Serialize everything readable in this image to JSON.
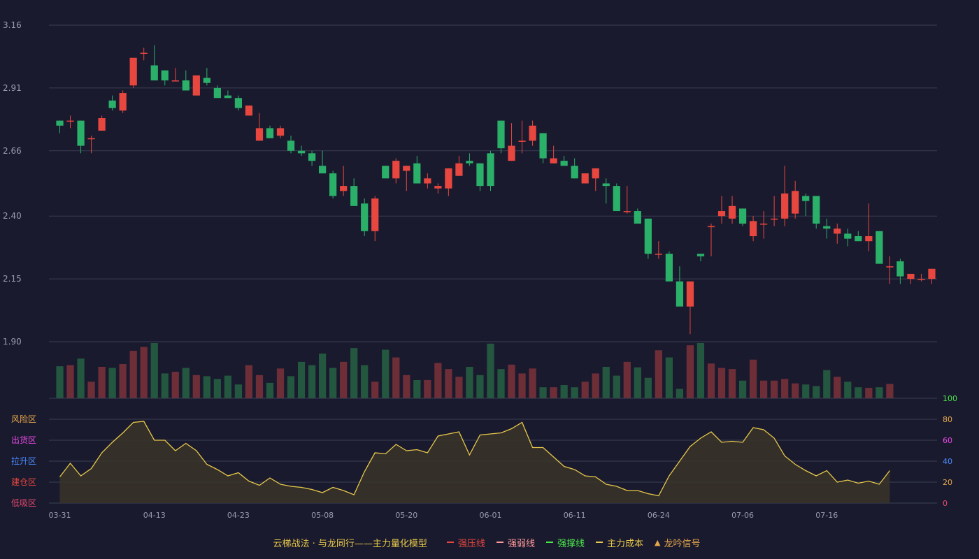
{
  "colors": {
    "background": "#1a1a2e",
    "up": "#e8473f",
    "down": "#2bb06a",
    "up_volume": "#6e2e38",
    "down_volume": "#24573f",
    "grid": "#3a3d52",
    "axis_text": "#9a9cad",
    "oscillator_line": "#e6c84a",
    "oscillator_fill": "#3a3428"
  },
  "chart_data": [
    {
      "type": "candlestick",
      "dates": [
        "03-31",
        "04-01",
        "04-02",
        "04-03",
        "04-06",
        "04-07",
        "04-08",
        "04-09",
        "04-10",
        "04-13",
        "04-14",
        "04-15",
        "04-16",
        "04-17",
        "04-20",
        "04-21",
        "04-22",
        "04-23",
        "04-24",
        "04-27",
        "04-28",
        "04-29",
        "04-30",
        "05-01",
        "05-04",
        "05-05",
        "05-06",
        "05-07",
        "05-08",
        "05-11",
        "05-12",
        "05-13",
        "05-14",
        "05-15",
        "05-18",
        "05-19",
        "05-20",
        "05-21",
        "05-22",
        "05-25",
        "05-26",
        "05-27",
        "05-28",
        "05-29",
        "06-01",
        "06-02",
        "06-03",
        "06-04",
        "06-05",
        "06-08",
        "06-09",
        "06-10",
        "06-11",
        "06-12",
        "06-15",
        "06-16",
        "06-17",
        "06-18",
        "06-19",
        "06-22",
        "06-23",
        "06-24",
        "06-25",
        "06-26",
        "06-29",
        "06-30",
        "07-01",
        "07-02",
        "07-03",
        "07-06",
        "07-07",
        "07-08",
        "07-09",
        "07-10",
        "07-13",
        "07-14",
        "07-15",
        "07-16",
        "07-17",
        "07-20",
        "07-21",
        "07-22",
        "07-23",
        "07-24",
        "07-27",
        "07-28",
        "07-29",
        "07-30",
        "07-31",
        "08-03"
      ],
      "ohlc": [
        [
          2.78,
          2.78,
          2.73,
          2.76
        ],
        [
          2.78,
          2.8,
          2.75,
          2.78
        ],
        [
          2.78,
          2.78,
          2.65,
          2.68
        ],
        [
          2.71,
          2.72,
          2.65,
          2.71
        ],
        [
          2.74,
          2.8,
          2.74,
          2.79
        ],
        [
          2.86,
          2.88,
          2.82,
          2.83
        ],
        [
          2.82,
          2.9,
          2.81,
          2.89
        ],
        [
          2.92,
          3.0,
          2.91,
          3.03
        ],
        [
          3.05,
          3.07,
          3.02,
          3.05
        ],
        [
          3.0,
          3.08,
          2.97,
          2.94
        ],
        [
          2.98,
          2.98,
          2.92,
          2.94
        ],
        [
          2.94,
          2.99,
          2.94,
          2.94
        ],
        [
          2.94,
          2.98,
          2.9,
          2.9
        ],
        [
          2.88,
          2.96,
          2.88,
          2.96
        ],
        [
          2.95,
          2.99,
          2.92,
          2.93
        ],
        [
          2.91,
          2.92,
          2.87,
          2.87
        ],
        [
          2.88,
          2.9,
          2.87,
          2.87
        ],
        [
          2.87,
          2.88,
          2.82,
          2.83
        ],
        [
          2.8,
          2.84,
          2.8,
          2.84
        ],
        [
          2.7,
          2.81,
          2.7,
          2.75
        ],
        [
          2.75,
          2.76,
          2.71,
          2.71
        ],
        [
          2.72,
          2.76,
          2.71,
          2.75
        ],
        [
          2.7,
          2.72,
          2.65,
          2.66
        ],
        [
          2.66,
          2.68,
          2.64,
          2.65
        ],
        [
          2.65,
          2.66,
          2.6,
          2.62
        ],
        [
          2.6,
          2.66,
          2.57,
          2.57
        ],
        [
          2.57,
          2.58,
          2.47,
          2.48
        ],
        [
          2.5,
          2.6,
          2.48,
          2.52
        ],
        [
          2.52,
          2.55,
          2.45,
          2.44
        ],
        [
          2.45,
          2.47,
          2.32,
          2.34
        ],
        [
          2.34,
          2.48,
          2.3,
          2.47
        ],
        [
          2.6,
          2.6,
          2.58,
          2.55
        ],
        [
          2.55,
          2.63,
          2.53,
          2.62
        ],
        [
          2.58,
          2.6,
          2.5,
          2.6
        ],
        [
          2.61,
          2.64,
          2.54,
          2.53
        ],
        [
          2.53,
          2.57,
          2.51,
          2.55
        ],
        [
          2.51,
          2.53,
          2.49,
          2.52
        ],
        [
          2.51,
          2.59,
          2.48,
          2.59
        ],
        [
          2.56,
          2.64,
          2.56,
          2.61
        ],
        [
          2.62,
          2.65,
          2.6,
          2.61
        ],
        [
          2.61,
          2.61,
          2.5,
          2.52
        ],
        [
          2.65,
          2.66,
          2.5,
          2.52
        ],
        [
          2.78,
          2.78,
          2.65,
          2.67
        ],
        [
          2.62,
          2.77,
          2.62,
          2.68
        ],
        [
          2.7,
          2.78,
          2.65,
          2.7
        ],
        [
          2.7,
          2.78,
          2.68,
          2.76
        ],
        [
          2.73,
          2.73,
          2.61,
          2.63
        ],
        [
          2.61,
          2.68,
          2.61,
          2.63
        ],
        [
          2.62,
          2.64,
          2.61,
          2.6
        ],
        [
          2.6,
          2.63,
          2.55,
          2.55
        ],
        [
          2.53,
          2.57,
          2.53,
          2.57
        ],
        [
          2.55,
          2.59,
          2.5,
          2.59
        ],
        [
          2.53,
          2.55,
          2.45,
          2.52
        ],
        [
          2.52,
          2.53,
          2.42,
          2.42
        ],
        [
          2.42,
          2.52,
          2.41,
          2.42
        ],
        [
          2.42,
          2.43,
          2.41,
          2.37
        ],
        [
          2.39,
          2.39,
          2.23,
          2.25
        ],
        [
          2.25,
          2.3,
          2.23,
          2.25
        ],
        [
          2.25,
          2.26,
          2.15,
          2.14
        ],
        [
          2.14,
          2.2,
          2.05,
          2.04
        ],
        [
          2.04,
          2.14,
          1.93,
          2.14
        ],
        [
          2.25,
          2.25,
          2.22,
          2.24
        ],
        [
          2.36,
          2.37,
          2.24,
          2.36
        ],
        [
          2.4,
          2.48,
          2.37,
          2.42
        ],
        [
          2.39,
          2.48,
          2.37,
          2.44
        ],
        [
          2.43,
          2.43,
          2.36,
          2.37
        ],
        [
          2.32,
          2.4,
          2.3,
          2.38
        ],
        [
          2.37,
          2.42,
          2.31,
          2.37
        ],
        [
          2.39,
          2.48,
          2.36,
          2.39
        ],
        [
          2.39,
          2.6,
          2.36,
          2.49
        ],
        [
          2.41,
          2.54,
          2.39,
          2.5
        ],
        [
          2.48,
          2.49,
          2.4,
          2.46
        ],
        [
          2.48,
          2.48,
          2.35,
          2.37
        ],
        [
          2.36,
          2.39,
          2.31,
          2.35
        ],
        [
          2.33,
          2.37,
          2.29,
          2.35
        ],
        [
          2.33,
          2.35,
          2.28,
          2.31
        ],
        [
          2.32,
          2.34,
          2.3,
          2.3
        ],
        [
          2.3,
          2.45,
          2.26,
          2.32
        ],
        [
          2.34,
          2.34,
          2.21,
          2.21
        ],
        [
          2.2,
          2.24,
          2.13,
          2.2
        ],
        [
          2.22,
          2.23,
          2.13,
          2.16
        ],
        [
          2.15,
          2.17,
          2.13,
          2.17
        ],
        [
          2.15,
          2.17,
          2.14,
          2.15
        ],
        [
          2.15,
          2.18,
          2.13,
          2.19
        ]
      ],
      "ylim": [
        1.9,
        3.16
      ],
      "y_ticks": [
        "1.90",
        "2.15",
        "2.40",
        "2.66",
        "2.91",
        "3.16"
      ],
      "x_tick_labels": [
        {
          "index": 0,
          "label": "03-31"
        },
        {
          "index": 9,
          "label": "04-13"
        },
        {
          "index": 17,
          "label": "04-23"
        },
        {
          "index": 25,
          "label": "05-08"
        },
        {
          "index": 33,
          "label": "05-20"
        },
        {
          "index": 41,
          "label": "06-01"
        },
        {
          "index": 49,
          "label": "06-11"
        },
        {
          "index": 57,
          "label": "06-24"
        },
        {
          "index": 65,
          "label": "07-06"
        },
        {
          "index": 73,
          "label": "07-16"
        }
      ]
    },
    {
      "type": "bar",
      "name": "volume",
      "values": [
        58,
        60,
        72,
        30,
        57,
        55,
        62,
        86,
        93,
        100,
        45,
        48,
        55,
        42,
        40,
        35,
        41,
        25,
        60,
        42,
        28,
        54,
        40,
        66,
        60,
        81,
        55,
        66,
        91,
        60,
        30,
        88,
        74,
        42,
        33,
        33,
        64,
        53,
        39,
        57,
        42,
        99,
        53,
        61,
        45,
        54,
        20,
        20,
        24,
        20,
        30,
        45,
        57,
        41,
        66,
        56,
        37,
        87,
        74,
        17,
        96,
        100,
        63,
        55,
        53,
        32,
        70,
        32,
        32,
        35,
        27,
        25,
        22,
        51,
        39,
        30,
        20,
        19,
        20,
        26
      ],
      "ylim": [
        0,
        100
      ],
      "y_tick": "100"
    },
    {
      "type": "area",
      "name": "主力量化模型",
      "values": [
        25,
        38,
        26,
        33,
        48,
        58,
        67,
        77,
        78,
        60,
        60,
        50,
        57,
        50,
        37,
        32,
        26,
        29,
        21,
        17,
        24,
        18,
        16,
        15,
        13,
        10,
        15,
        12,
        8,
        30,
        48,
        47,
        56,
        50,
        51,
        48,
        64,
        66,
        68,
        46,
        65,
        66,
        67,
        71,
        77,
        53,
        53,
        44,
        35,
        32,
        26,
        25,
        18,
        16,
        12,
        12,
        9,
        7,
        26,
        40,
        54,
        62,
        68,
        58,
        59,
        58,
        72,
        70,
        62,
        45,
        37,
        31,
        26,
        31,
        20,
        22,
        19,
        21,
        18,
        31
      ],
      "ylim": [
        0,
        80
      ],
      "y_ticks": [
        "0",
        "20",
        "40",
        "60",
        "80"
      ],
      "zones": [
        "低吸区",
        "建仓区",
        "拉升区",
        "出货区",
        "风险区"
      ]
    }
  ],
  "zone_colors": [
    "#e84a6f",
    "#e8473f",
    "#4a8cff",
    "#e64ae6",
    "#e6a84a"
  ],
  "right_tick_colors": [
    "#e84a6f",
    "#e6a84a",
    "#4a8cff",
    "#e64ae6",
    "#e6a84a"
  ],
  "volume_tick_color": "#4ae64a",
  "legend": {
    "title": "云梯战法 · 与龙同行——主力量化模型",
    "items": [
      {
        "label": "强压线",
        "color": "#e8473f",
        "style": "solid"
      },
      {
        "label": "强弱线",
        "color": "#ff9a9a",
        "style": "dashed"
      },
      {
        "label": "强撑线",
        "color": "#4ae64a",
        "style": "solid"
      },
      {
        "label": "主力成本",
        "color": "#e6c84a",
        "style": "dashed"
      },
      {
        "label": "龙吟信号",
        "color": "#e6a84a",
        "style": "triangle"
      }
    ]
  }
}
